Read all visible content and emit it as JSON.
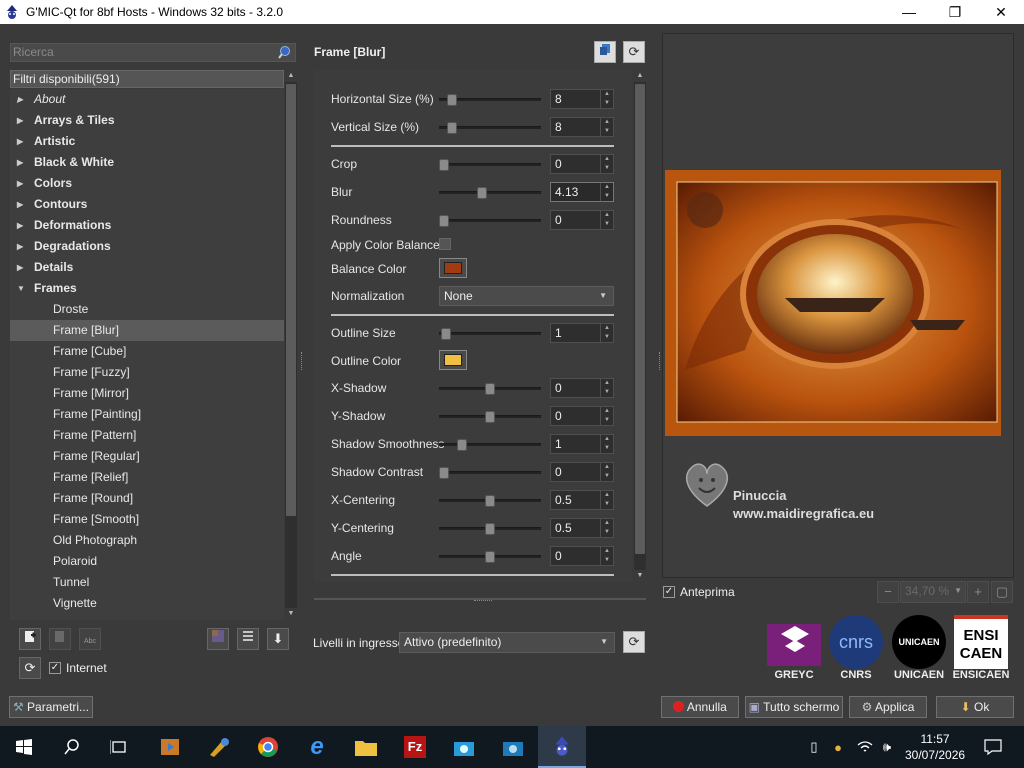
{
  "window": {
    "title": "G'MIC-Qt for 8bf Hosts - Windows 32 bits - 3.2.0",
    "minimize": "—",
    "maximize": "❐",
    "close": "✕"
  },
  "search": {
    "placeholder": "Ricerca"
  },
  "filters": {
    "header": "Filtri disponibili(591)",
    "categories": [
      "About",
      "Arrays & Tiles",
      "Artistic",
      "Black & White",
      "Colors",
      "Contours",
      "Deformations",
      "Degradations",
      "Details",
      "Frames"
    ],
    "frames_children": [
      "Droste",
      "Frame [Blur]",
      "Frame [Cube]",
      "Frame [Fuzzy]",
      "Frame [Mirror]",
      "Frame [Painting]",
      "Frame [Pattern]",
      "Frame [Regular]",
      "Frame [Relief]",
      "Frame [Round]",
      "Frame [Smooth]",
      "Old Photograph",
      "Polaroid",
      "Tunnel",
      "Vignette"
    ],
    "selected": "Frame [Blur]"
  },
  "internet_label": "Internet",
  "params_button": "Parametri...",
  "filter": {
    "title": "Frame [Blur]",
    "params": [
      {
        "label": "Horizontal Size (%)",
        "value": "8",
        "pos": 0.12
      },
      {
        "label": "Vertical Size (%)",
        "value": "8",
        "pos": 0.12
      },
      {
        "label": "Crop",
        "value": "0",
        "pos": 0.0
      },
      {
        "label": "Blur",
        "value": "4.13",
        "pos": 0.41
      },
      {
        "label": "Roundness",
        "value": "0",
        "pos": 0.0
      },
      {
        "label": "Apply Color Balance"
      },
      {
        "label": "Balance Color",
        "color": "#a23a12"
      },
      {
        "label": "Normalization",
        "value": "None"
      },
      {
        "label": "Outline Size",
        "value": "1",
        "pos": 0.02
      },
      {
        "label": "Outline Color",
        "color": "#f2c040"
      },
      {
        "label": "X-Shadow",
        "value": "0",
        "pos": 0.5
      },
      {
        "label": "Y-Shadow",
        "value": "0",
        "pos": 0.5
      },
      {
        "label": "Shadow Smoothness",
        "value": "1",
        "pos": 0.22
      },
      {
        "label": "Shadow Contrast",
        "value": "0",
        "pos": 0.0
      },
      {
        "label": "X-Centering",
        "value": "0.5",
        "pos": 0.5
      },
      {
        "label": "Y-Centering",
        "value": "0.5",
        "pos": 0.5
      },
      {
        "label": "Angle",
        "value": "0",
        "pos": 0.5
      }
    ]
  },
  "input_layers": {
    "label": "Livelli in ingresso",
    "value": "Attivo (predefinito)"
  },
  "preview": {
    "checkbox_label": "Anteprima",
    "zoom": "34,70 %",
    "watermark_name": "Pinuccia",
    "watermark_url": "www.maidiregrafica.eu"
  },
  "logos": [
    "GREYC",
    "CNRS",
    "UNICAEN",
    "ENSICAEN"
  ],
  "buttons": {
    "cancel": "Annulla",
    "fullscreen": "Tutto schermo",
    "apply": "Applica",
    "ok": "Ok"
  },
  "taskbar": {
    "time": "11:57",
    "date": "30/07/2026"
  }
}
